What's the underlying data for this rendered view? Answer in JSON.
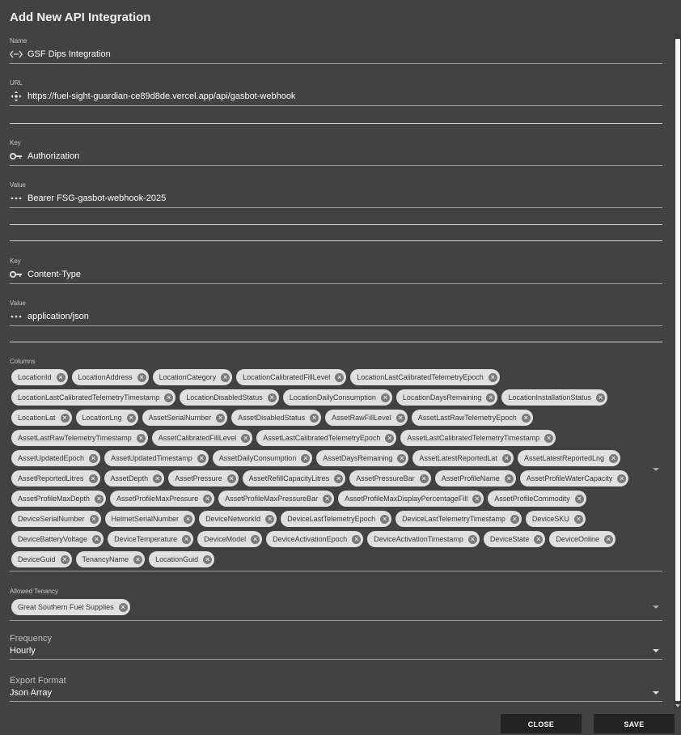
{
  "dialog": {
    "title": "Add New API Integration"
  },
  "name": {
    "label": "Name",
    "value": "GSF Dips Integration"
  },
  "url": {
    "label": "URL",
    "value": "https://fuel-sight-guardian-ce89d8de.vercel.app/api/gasbot-webhook"
  },
  "headers": [
    {
      "key_label": "Key",
      "key": "Authorization",
      "value_label": "Value",
      "value": "Bearer FSG-gasbot-webhook-2025"
    },
    {
      "key_label": "Key",
      "key": "Content-Type",
      "value_label": "Value",
      "value": "application/json"
    }
  ],
  "columns": {
    "label": "Columns",
    "items": [
      "LocationId",
      "LocationAddress",
      "LocationCategory",
      "LocationCalibratedFillLevel",
      "LocationLastCalibratedTelemetryEpoch",
      "LocationLastCalibratedTelemetryTimestamp",
      "LocationDisabledStatus",
      "LocationDailyConsumption",
      "LocationDaysRemaining",
      "LocationInstallationStatus",
      "LocationLat",
      "LocationLng",
      "AssetSerialNumber",
      "AssetDisabledStatus",
      "AssetRawFillLevel",
      "AssetLastRawTelemetryEpoch",
      "AssetLastRawTelemetryTimestamp",
      "AssetCalibratedFillLevel",
      "AssetLastCalibratedTelemetryEpoch",
      "AssetLastCalibratedTelemetryTimestamp",
      "AssetUpdatedEpoch",
      "AssetUpdatedTimestamp",
      "AssetDailyConsumption",
      "AssetDaysRemaining",
      "AssetLatestReportedLat",
      "AssetLatestReportedLng",
      "AssetReportedLitres",
      "AssetDepth",
      "AssetPressure",
      "AssetRefillCapacityLitres",
      "AssetPressureBar",
      "AssetProfileName",
      "AssetProfileWaterCapacity",
      "AssetProfileMaxDepth",
      "AssetProfileMaxPressure",
      "AssetProfileMaxPressureBar",
      "AssetProfileMaxDisplayPercentageFill",
      "AssetProfileCommodity",
      "DeviceSerialNumber",
      "HelmetSerialNumber",
      "DeviceNetworkId",
      "DeviceLastTelemetryEpoch",
      "DeviceLastTelemetryTimestamp",
      "DeviceSKU",
      "DeviceBatteryVoltage",
      "DeviceTemperature",
      "DeviceModel",
      "DeviceActivationEpoch",
      "DeviceActivationTimestamp",
      "DeviceState",
      "DeviceOnline",
      "DeviceGuid",
      "TenancyName",
      "LocationGuid"
    ]
  },
  "tenancy": {
    "label": "Allowed Tenancy",
    "items": [
      "Great Southern Fuel Supplies"
    ]
  },
  "frequency": {
    "label": "Frequency",
    "value": "Hourly"
  },
  "export_format": {
    "label": "Export Format",
    "value": "Json Array"
  },
  "buttons": {
    "close": "CLOSE",
    "save": "SAVE"
  },
  "icons": {
    "name": "code-icon",
    "url": "move-icon",
    "key": "key-icon",
    "value": "dots-icon",
    "chip_remove": "remove-circle-icon",
    "dropdown": "caret-down-icon"
  }
}
